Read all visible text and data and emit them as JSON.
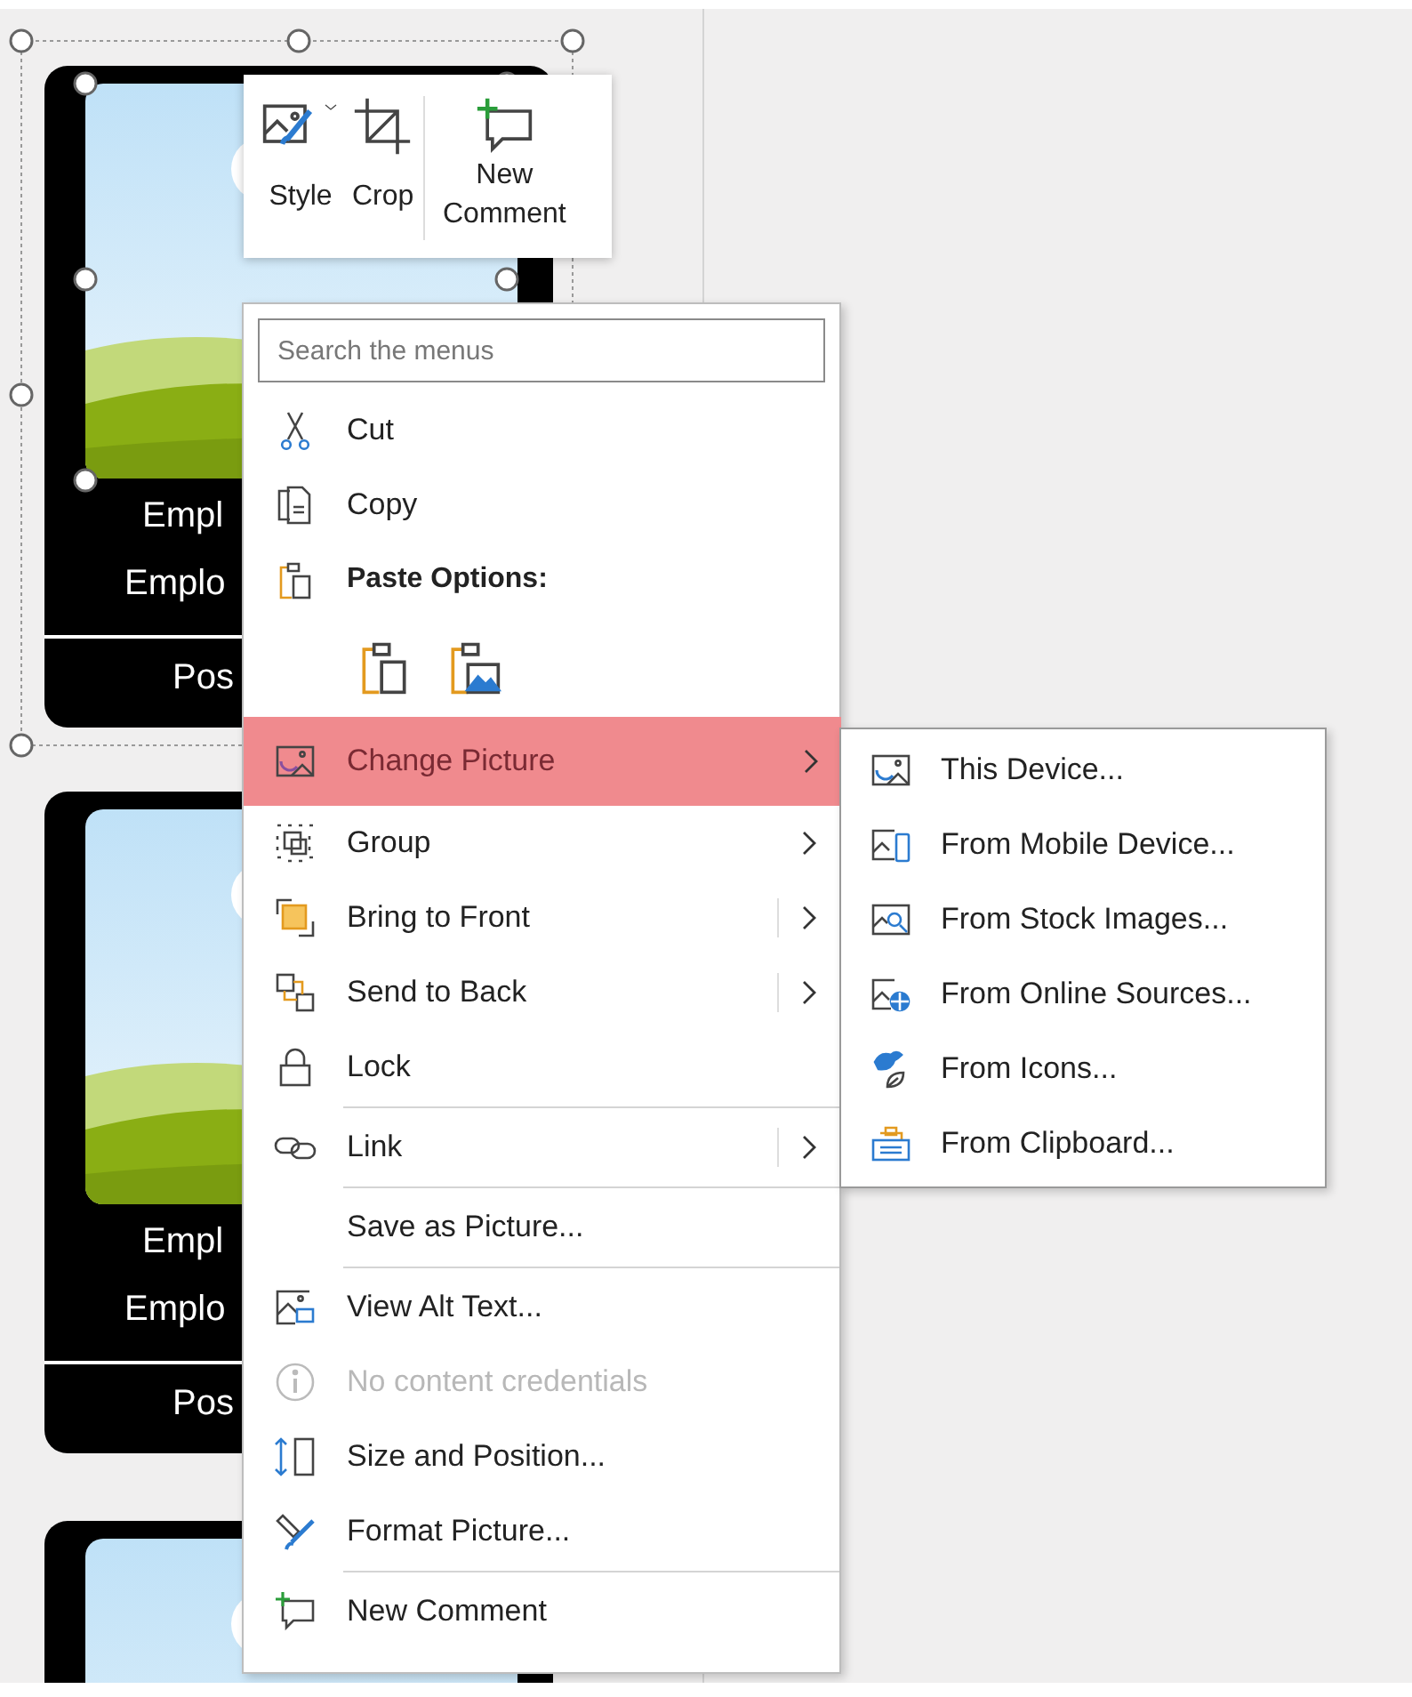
{
  "cards": [
    {
      "selected": true,
      "lines": [
        "Empl",
        "Emplo"
      ],
      "footer": "Pos"
    },
    {
      "selected": false,
      "lines": [
        "Empl",
        "Emplo"
      ],
      "footer": "Pos"
    },
    {
      "selected": false
    }
  ],
  "toolbar": {
    "buttons": [
      {
        "label": "Style"
      },
      {
        "label": "Crop"
      },
      {
        "label": "New Comment"
      }
    ]
  },
  "context_menu": {
    "search": {
      "placeholder": "Search the menus"
    },
    "items": [
      {
        "kind": "item",
        "label": "Cut",
        "selected": false,
        "disabled": false,
        "submenu": false,
        "split": false
      },
      {
        "kind": "item",
        "label": "Copy",
        "selected": false,
        "disabled": false,
        "submenu": false,
        "split": false
      },
      {
        "kind": "header",
        "label": "Paste Options:"
      },
      {
        "kind": "paste_icons"
      },
      {
        "kind": "item",
        "label": "Change Picture",
        "selected": true,
        "disabled": false,
        "submenu": true,
        "split": false
      },
      {
        "kind": "item",
        "label": "Group",
        "selected": false,
        "disabled": false,
        "submenu": true,
        "split": false
      },
      {
        "kind": "item",
        "label": "Bring to Front",
        "selected": false,
        "disabled": false,
        "submenu": true,
        "split": true
      },
      {
        "kind": "item",
        "label": "Send to Back",
        "selected": false,
        "disabled": false,
        "submenu": true,
        "split": true
      },
      {
        "kind": "item",
        "label": "Lock",
        "selected": false,
        "disabled": false,
        "submenu": false,
        "split": false,
        "separator_after": true
      },
      {
        "kind": "item",
        "label": "Link",
        "selected": false,
        "disabled": false,
        "submenu": true,
        "split": true,
        "separator_after": true
      },
      {
        "kind": "item",
        "label": "Save as Picture...",
        "selected": false,
        "disabled": false,
        "submenu": false,
        "split": false,
        "separator_after": true
      },
      {
        "kind": "item",
        "label": "View Alt Text...",
        "selected": false,
        "disabled": false,
        "submenu": false,
        "split": false
      },
      {
        "kind": "item",
        "label": "No content credentials",
        "selected": false,
        "disabled": true,
        "submenu": false,
        "split": false
      },
      {
        "kind": "item",
        "label": "Size and Position...",
        "selected": false,
        "disabled": false,
        "submenu": false,
        "split": false
      },
      {
        "kind": "item",
        "label": "Format Picture...",
        "selected": false,
        "disabled": false,
        "submenu": false,
        "split": false,
        "separator_after": true
      },
      {
        "kind": "item",
        "label": "New Comment",
        "selected": false,
        "disabled": false,
        "submenu": false,
        "split": false
      }
    ]
  },
  "submenu": {
    "items": [
      {
        "label": "This Device...",
        "selected": false
      },
      {
        "label": "From Mobile Device...",
        "selected": false
      },
      {
        "label": "From Stock Images...",
        "selected": false
      },
      {
        "label": "From Online Sources...",
        "selected": false
      },
      {
        "label": "From Icons...",
        "selected": false
      },
      {
        "label": "From Clipboard...",
        "selected": false
      }
    ]
  }
}
